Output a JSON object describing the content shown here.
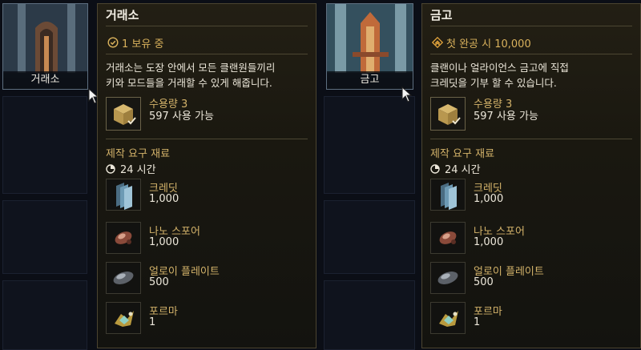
{
  "panels": [
    {
      "thumb_label": "거래소",
      "title": "거래소",
      "status_icon": "check-circle-icon",
      "status": "1 보유 중",
      "description_lines": [
        "거래소는 도장 안에서 모든 클랜원들끼리",
        "키와 모드들을 거래할 수 있게 해줍니다."
      ],
      "capacity": "수용량 3",
      "available": "597 사용 가능",
      "requirements_title": "제작 요구 재료",
      "time": "24 시간",
      "items": [
        {
          "name": "크레딧",
          "qty": "1,000",
          "icon": "credits-icon"
        },
        {
          "name": "나노 스포어",
          "qty": "1,000",
          "icon": "nano-spores-icon"
        },
        {
          "name": "얼로이 플레이트",
          "qty": "500",
          "icon": "alloy-plate-icon"
        },
        {
          "name": "포르마",
          "qty": "1",
          "icon": "forma-icon"
        }
      ]
    },
    {
      "thumb_label": "금고",
      "title": "금고",
      "status_icon": "clan-rank-icon",
      "status": "첫 완공 시 10,000",
      "description_lines": [
        "클랜이나 얼라이언스 금고에 직접",
        "크레딧을 기부 할 수 있습니다."
      ],
      "capacity": "수용량 3",
      "available": "597 사용 가능",
      "requirements_title": "제작 요구 재료",
      "time": "24 시간",
      "items": [
        {
          "name": "크레딧",
          "qty": "1,000",
          "icon": "credits-icon"
        },
        {
          "name": "나노 스포어",
          "qty": "1,000",
          "icon": "nano-spores-icon"
        },
        {
          "name": "얼로이 플레이트",
          "qty": "500",
          "icon": "alloy-plate-icon"
        },
        {
          "name": "포르마",
          "qty": "1",
          "icon": "forma-icon"
        }
      ]
    }
  ],
  "colors": {
    "accent_gold": "#d4b36a",
    "panel_border": "#4b4430"
  }
}
